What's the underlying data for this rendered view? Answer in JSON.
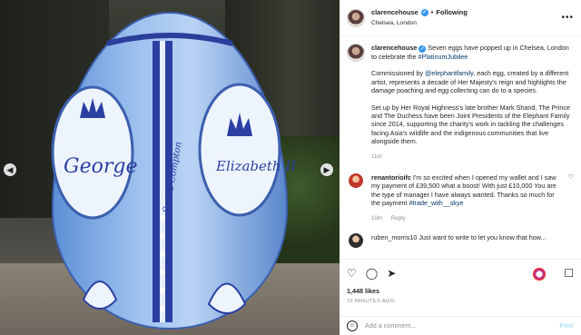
{
  "header": {
    "username": "clarencehouse",
    "verified_icon": "verified-badge-icon",
    "separator": "•",
    "following_label": "Following",
    "location": "Chelsea, London",
    "more_icon": "more-options-icon"
  },
  "photo": {
    "egg_text_left": "George",
    "egg_text_center": "Sasha Compton",
    "egg_text_right": "Elizabeth II",
    "prev_icon": "chevron-left-icon",
    "next_icon": "chevron-right-icon"
  },
  "caption": {
    "username": "clarencehouse",
    "line1": "Seven eggs have popped up in Chelsea, London to celebrate the ",
    "hashtag1": "#PlatinumJubilee",
    "para2_a": "Commissioned by ",
    "mention": "@elephantfamily",
    "para2_b": ", each egg, created by a different artist, represents a decade of Her Majesty's reign and highlights the damage poaching and egg collecting can do to a species.",
    "para3": "Set up by Her Royal Highness's late brother Mark Shand, The Prince and The Duchess have been Joint Presidents of the Elephant Family since 2014, supporting the charity's work in tackling the challenges facing Asia's wildlife and the indigenous communities that live alongside them.",
    "time": "11m"
  },
  "comment": {
    "username": "renantorioifc",
    "text": " I'm so excited when I opened my wallet and I saw my payment of £39,500 what a boost! With just £10,000 You are the type of manager I have always wanted. Thanks so much for the payment ",
    "hashtag": "#trade_with__skye",
    "time": "10m",
    "reply_label": "Reply"
  },
  "comment_partial": {
    "text": "ruben_morris10 Just want to write to let you know that how..."
  },
  "actions": {
    "like_icon": "heart-icon",
    "comment_icon": "comment-icon",
    "share_icon": "share-icon",
    "bookmark_icon": "bookmark-icon",
    "likes": "1,448 likes",
    "time_ago": "16 MINUTES AGO"
  },
  "add_comment": {
    "emoji_icon": "emoji-icon",
    "placeholder": "Add a comment...",
    "post_label": "Post"
  }
}
